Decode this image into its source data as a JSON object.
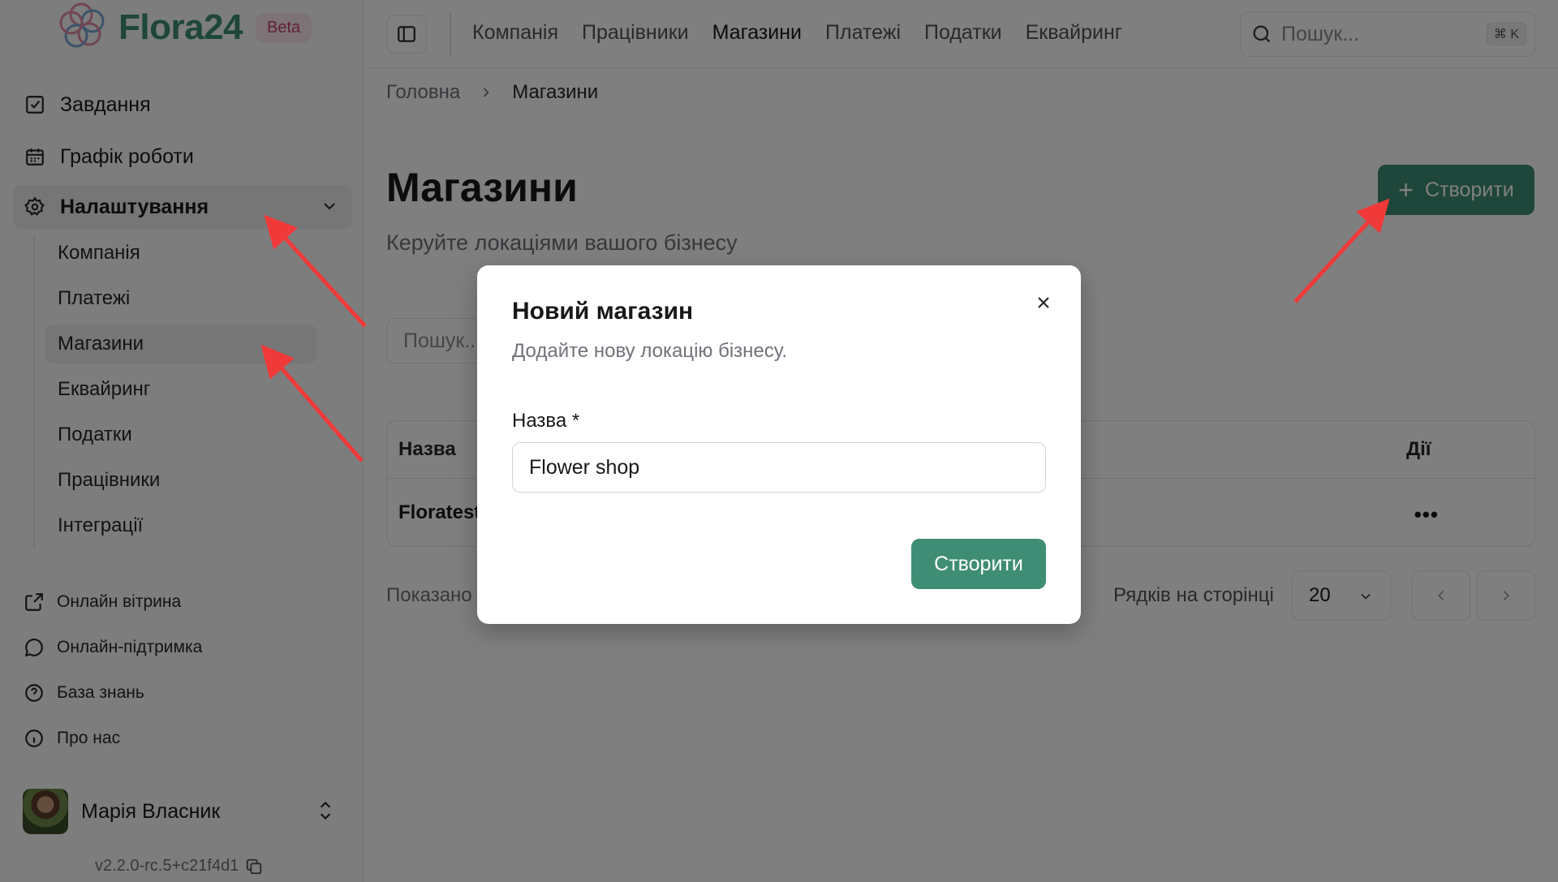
{
  "brand": {
    "name": "Flora24",
    "badge": "Beta"
  },
  "sidebar": {
    "items": [
      {
        "label": "Завдання",
        "icon": "checkbox-icon"
      },
      {
        "label": "Графік роботи",
        "icon": "calendar-icon"
      },
      {
        "label": "Налаштування",
        "icon": "gear-icon",
        "expanded": true
      }
    ],
    "settings_items": [
      "Компанія",
      "Платежі",
      "Магазини",
      "Еквайринг",
      "Податки",
      "Працівники",
      "Інтеграції"
    ],
    "active_settings_item": "Магазини",
    "footer_links": [
      {
        "label": "Онлайн вітрина",
        "icon": "external-link-icon"
      },
      {
        "label": "Онлайн-підтримка",
        "icon": "chat-bubble-icon"
      },
      {
        "label": "База знань",
        "icon": "help-circle-icon"
      },
      {
        "label": "Про нас",
        "icon": "info-icon"
      }
    ],
    "user": {
      "name": "Марія Власник"
    },
    "version": "v2.2.0-rc.5+c21f4d1"
  },
  "topbar": {
    "nav": [
      "Компанія",
      "Працівники",
      "Магазини",
      "Платежі",
      "Податки",
      "Еквайринг"
    ],
    "active": "Магазини",
    "search_placeholder": "Пошук...",
    "shortcut": "⌘ K"
  },
  "breadcrumb": {
    "home": "Головна",
    "current": "Магазини"
  },
  "page": {
    "title": "Магазини",
    "subtitle": "Керуйте локаціями вашого бізнесу",
    "create_label": "Створити",
    "filter_placeholder": "Пошук..."
  },
  "table": {
    "col_name": "Назва",
    "col_actions": "Дії",
    "rows": [
      {
        "name": "Floratest",
        "actions": "•••"
      }
    ]
  },
  "pagination": {
    "shown_text": "Показано",
    "rows_label": "Рядків на сторінці",
    "rows_value": "20"
  },
  "modal": {
    "title": "Новий магазин",
    "subtitle": "Додайте нову локацію бізнесу.",
    "field_label": "Назва *",
    "field_value": "Flower shop",
    "submit_label": "Створити"
  },
  "colors": {
    "accent": "#3f8d74",
    "brand": "#3c8f72",
    "annotation_arrow": "#f03a3a"
  }
}
